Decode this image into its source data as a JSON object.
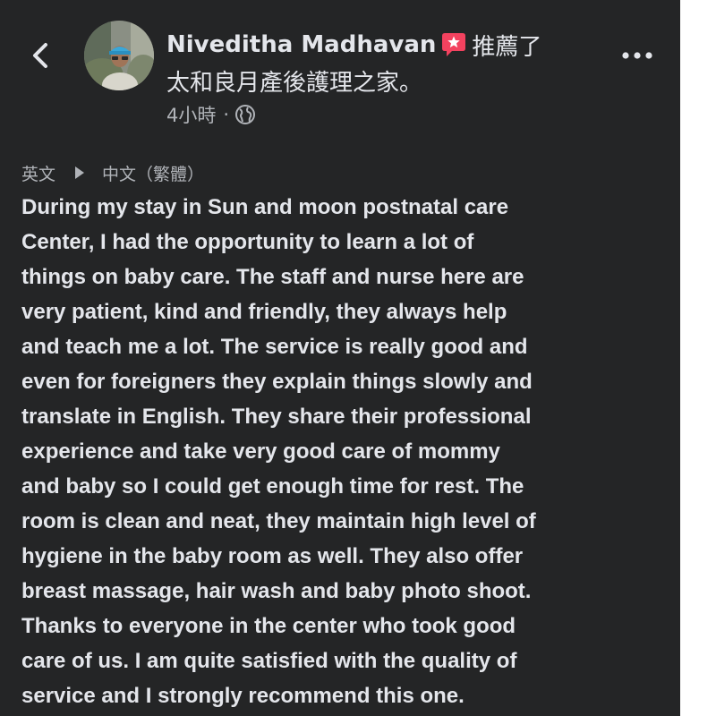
{
  "post": {
    "author_name": "Niveditha Madhavan",
    "recommend_verb": "推薦了",
    "page_name": "太和良月產後護理之家。",
    "timestamp": "4小時",
    "separator": "·",
    "privacy_icon": "globe-icon",
    "recommend_icon": "recommend-star-icon"
  },
  "navigation": {
    "back_icon": "chevron-left-icon",
    "more_icon": "more-dots-icon"
  },
  "translation": {
    "source_lang": "英文",
    "arrow_icon": "play-arrow-icon",
    "target_lang": "中文（繁體）"
  },
  "review": {
    "lines": [
      "During my stay in Sun and moon postnatal care",
      "Center, I had the opportunity to learn a lot of",
      "things on baby care. The staff and nurse here are",
      "very patient, kind and friendly, they always help",
      "and teach me a lot. The service is really good and",
      "even for foreigners they explain things slowly and",
      "translate in English. They share their professional",
      "experience and take very good care of mommy",
      "and baby so I could get enough time for rest. The",
      "room is clean and neat, they maintain high level of",
      "hygiene in the baby room as well. They also offer",
      "breast massage, hair wash and baby photo shoot.",
      "Thanks to everyone in the center who took good",
      "care of us. I am quite satisfied with the quality of",
      "service and I strongly recommend this one."
    ]
  },
  "colors": {
    "background": "#242526",
    "primary_text": "#e4e6eb",
    "secondary_text": "#b0b3b8",
    "recommend_badge": "#f3425f"
  }
}
